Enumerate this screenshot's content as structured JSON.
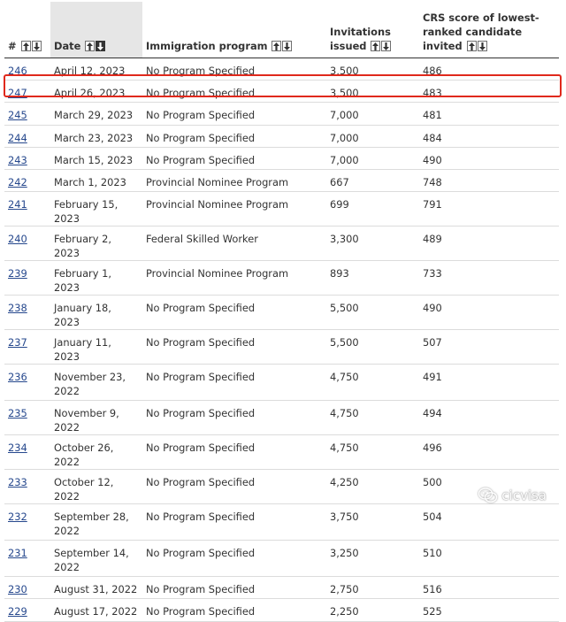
{
  "columns": [
    {
      "key": "num",
      "label": "#"
    },
    {
      "key": "date",
      "label": "Date"
    },
    {
      "key": "program",
      "label": "Immigration program"
    },
    {
      "key": "invitations",
      "label": "Invitations issued"
    },
    {
      "key": "crs",
      "label": "CRS score of lowest-ranked candidate invited"
    }
  ],
  "rows": [
    {
      "num": "246",
      "date": "April 12, 2023",
      "program": "No Program Specified",
      "invitations": "3,500",
      "crs": "486"
    },
    {
      "num": "247",
      "date": "April 26, 2023",
      "program": "No Program Specified",
      "invitations": "3,500",
      "crs": "483"
    },
    {
      "num": "245",
      "date": "March 29, 2023",
      "program": "No Program Specified",
      "invitations": "7,000",
      "crs": "481"
    },
    {
      "num": "244",
      "date": "March 23, 2023",
      "program": "No Program Specified",
      "invitations": "7,000",
      "crs": "484"
    },
    {
      "num": "243",
      "date": "March 15, 2023",
      "program": "No Program Specified",
      "invitations": "7,000",
      "crs": "490"
    },
    {
      "num": "242",
      "date": "March 1, 2023",
      "program": "Provincial Nominee Program",
      "invitations": "667",
      "crs": "748"
    },
    {
      "num": "241",
      "date": "February 15, 2023",
      "program": "Provincial Nominee Program",
      "invitations": "699",
      "crs": "791"
    },
    {
      "num": "240",
      "date": "February 2, 2023",
      "program": "Federal Skilled Worker",
      "invitations": "3,300",
      "crs": "489"
    },
    {
      "num": "239",
      "date": "February 1, 2023",
      "program": "Provincial Nominee Program",
      "invitations": "893",
      "crs": "733"
    },
    {
      "num": "238",
      "date": "January 18, 2023",
      "program": "No Program Specified",
      "invitations": "5,500",
      "crs": "490"
    },
    {
      "num": "237",
      "date": "January 11, 2023",
      "program": "No Program Specified",
      "invitations": "5,500",
      "crs": "507"
    },
    {
      "num": "236",
      "date": "November 23, 2022",
      "program": "No Program Specified",
      "invitations": "4,750",
      "crs": "491"
    },
    {
      "num": "235",
      "date": "November 9, 2022",
      "program": "No Program Specified",
      "invitations": "4,750",
      "crs": "494"
    },
    {
      "num": "234",
      "date": "October 26, 2022",
      "program": "No Program Specified",
      "invitations": "4,750",
      "crs": "496"
    },
    {
      "num": "233",
      "date": "October 12, 2022",
      "program": "No Program Specified",
      "invitations": "4,250",
      "crs": "500"
    },
    {
      "num": "232",
      "date": "September 28, 2022",
      "program": "No Program Specified",
      "invitations": "3,750",
      "crs": "504"
    },
    {
      "num": "231",
      "date": "September 14, 2022",
      "program": "No Program Specified",
      "invitations": "3,250",
      "crs": "510"
    },
    {
      "num": "230",
      "date": "August 31, 2022",
      "program": "No Program Specified",
      "invitations": "2,750",
      "crs": "516"
    },
    {
      "num": "229",
      "date": "August 17, 2022",
      "program": "No Program Specified",
      "invitations": "2,250",
      "crs": "525"
    }
  ],
  "highlighted_row": "247",
  "sort": {
    "column": "date",
    "direction": "descending"
  },
  "watermark": {
    "text": "cicvisa",
    "icon": "wechat-icon"
  },
  "colors": {
    "link": "#26488d",
    "highlight_border": "#e0291c",
    "sorted_header_bg": "#e6e6e6"
  }
}
